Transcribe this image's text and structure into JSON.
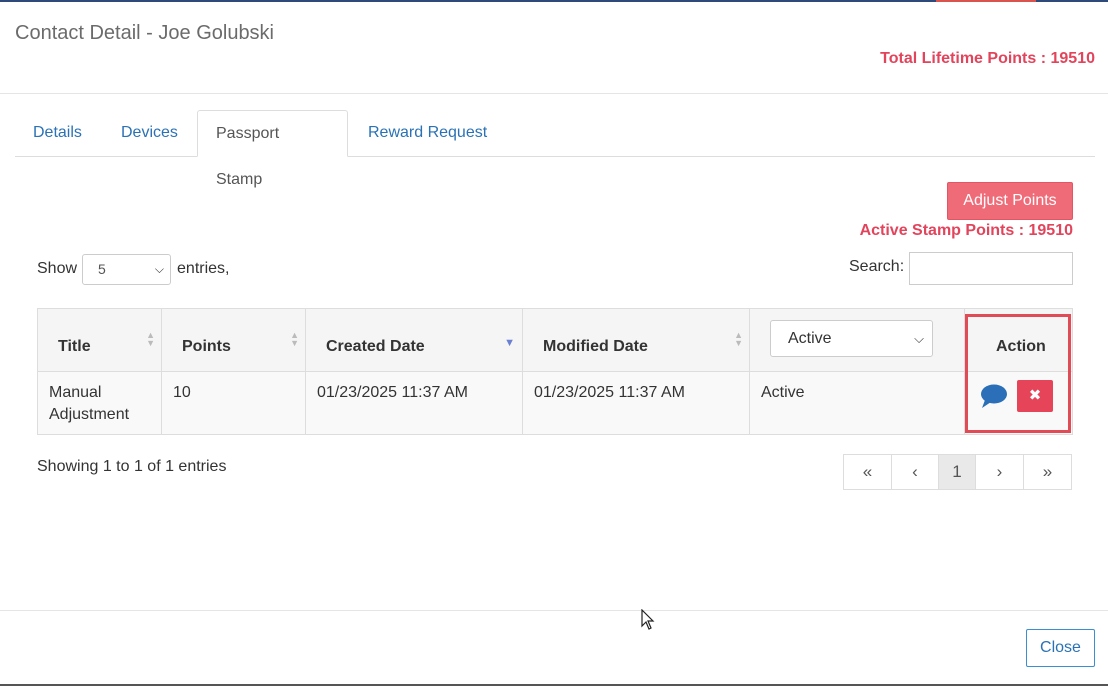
{
  "modal": {
    "title": "Contact Detail - Joe Golubski",
    "total_lifetime_points": "Total Lifetime Points : 19510"
  },
  "tabs": [
    {
      "label": "Details",
      "active": false
    },
    {
      "label": "Devices",
      "active": false
    },
    {
      "label": "Passport Stamp",
      "active": true
    },
    {
      "label": "Reward Request",
      "active": false
    }
  ],
  "toolbar": {
    "adjust_label": "Adjust Points",
    "active_stamp_points": "Active Stamp Points : 19510",
    "show_label": "Show",
    "entries_value": "5",
    "entries_label": "entries,",
    "search_label": "Search:",
    "search_value": ""
  },
  "table": {
    "headers": [
      "Title",
      "Points",
      "Created Date",
      "Modified Date",
      "Active",
      "Action"
    ],
    "status_filter": "Active",
    "rows": [
      {
        "title": "Manual\nAdjustment",
        "points": "10",
        "created": "01/23/2025 11:37 AM",
        "modified": "01/23/2025 11:37 AM",
        "status": "Active"
      }
    ]
  },
  "footer_info": {
    "showing": "Showing 1 to 1 of 1 entries"
  },
  "pagination": {
    "first": "«",
    "prev": "‹",
    "current": "1",
    "next": "›",
    "last": "»"
  },
  "footer": {
    "close_label": "Close"
  },
  "colors": {
    "accent_red": "#e2445c",
    "link_blue": "#2a72b5",
    "button_pink": "#ef6b78"
  }
}
